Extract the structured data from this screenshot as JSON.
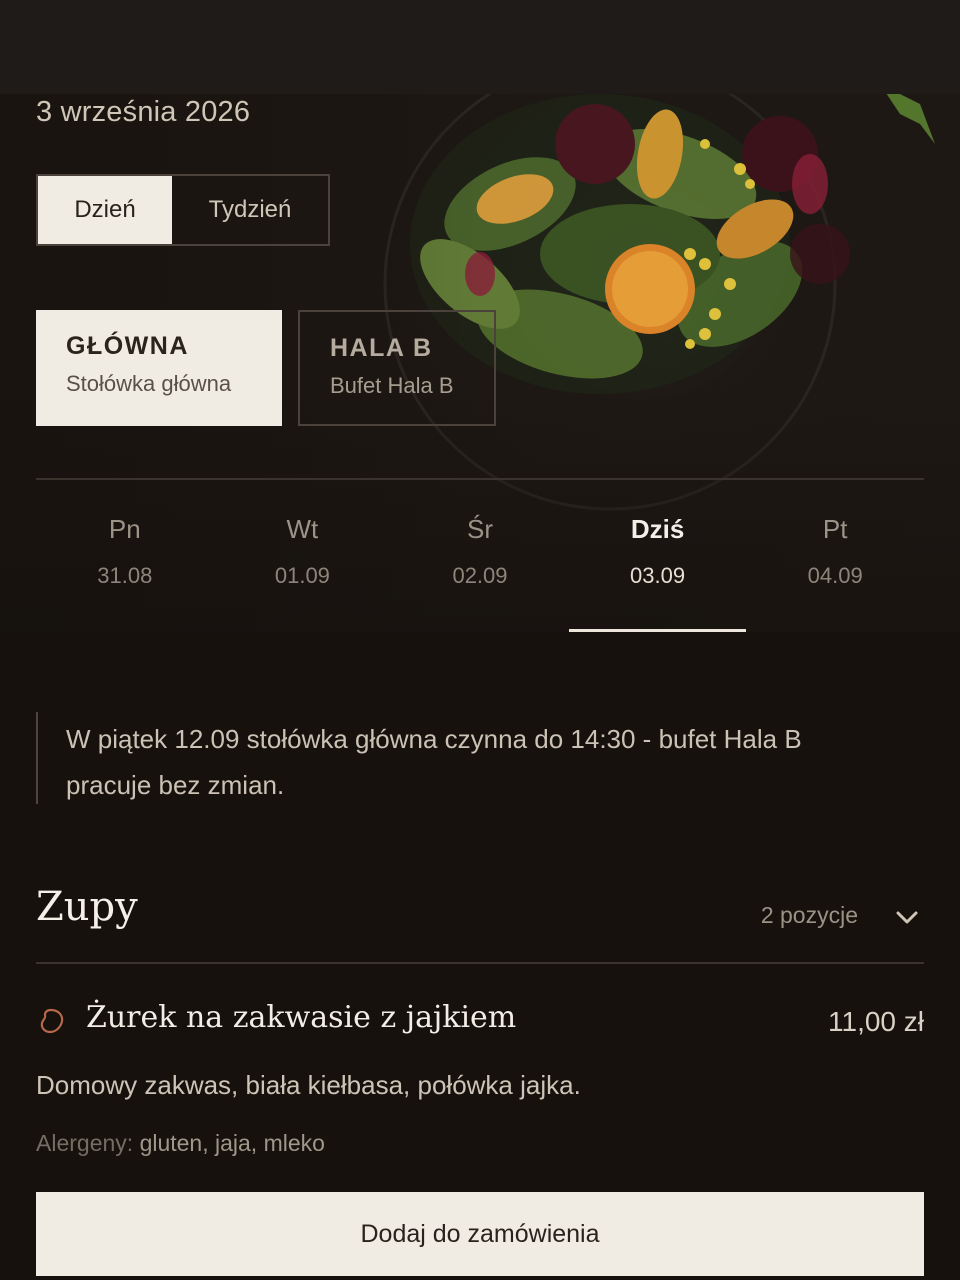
{
  "header": {
    "date_title": "3 września 2026"
  },
  "view_toggle": {
    "day_label": "Dzień",
    "week_label": "Tydzień",
    "selected": "day"
  },
  "locations": [
    {
      "code": "GŁÓWNA",
      "name": "Stołówka główna",
      "selected": true
    },
    {
      "code": "HALA B",
      "name": "Bufet Hala B",
      "selected": false
    }
  ],
  "days": [
    {
      "name": "Pn",
      "date": "31.08",
      "selected": false
    },
    {
      "name": "Wt",
      "date": "01.09",
      "selected": false
    },
    {
      "name": "Śr",
      "date": "02.09",
      "selected": false
    },
    {
      "name": "Dziś",
      "date": "03.09",
      "selected": true
    },
    {
      "name": "Pt",
      "date": "04.09",
      "selected": false
    }
  ],
  "notice": {
    "line1": "W piątek 12.09 stołówka główna czynna do 14:30 - bufet Hala B",
    "line2": "pracuje bez zmian."
  },
  "section": {
    "title": "Zupy",
    "count_label": "2 pozycje",
    "icon": "chevron-down-icon"
  },
  "item": {
    "icon": "egg-icon",
    "name": "Żurek na zakwasie z jajkiem",
    "price": "11,00 zł",
    "description": "Domowy zakwas, biała kiełbasa, połówka jajka.",
    "allergens_label": "Alergeny:",
    "allergens": "gluten, jaja, mleko",
    "add_button_label": "Dodaj do zamówienia"
  },
  "colors": {
    "background": "#16110d",
    "accent_light": "#f1ece3",
    "icon_accent": "#b8684a"
  }
}
